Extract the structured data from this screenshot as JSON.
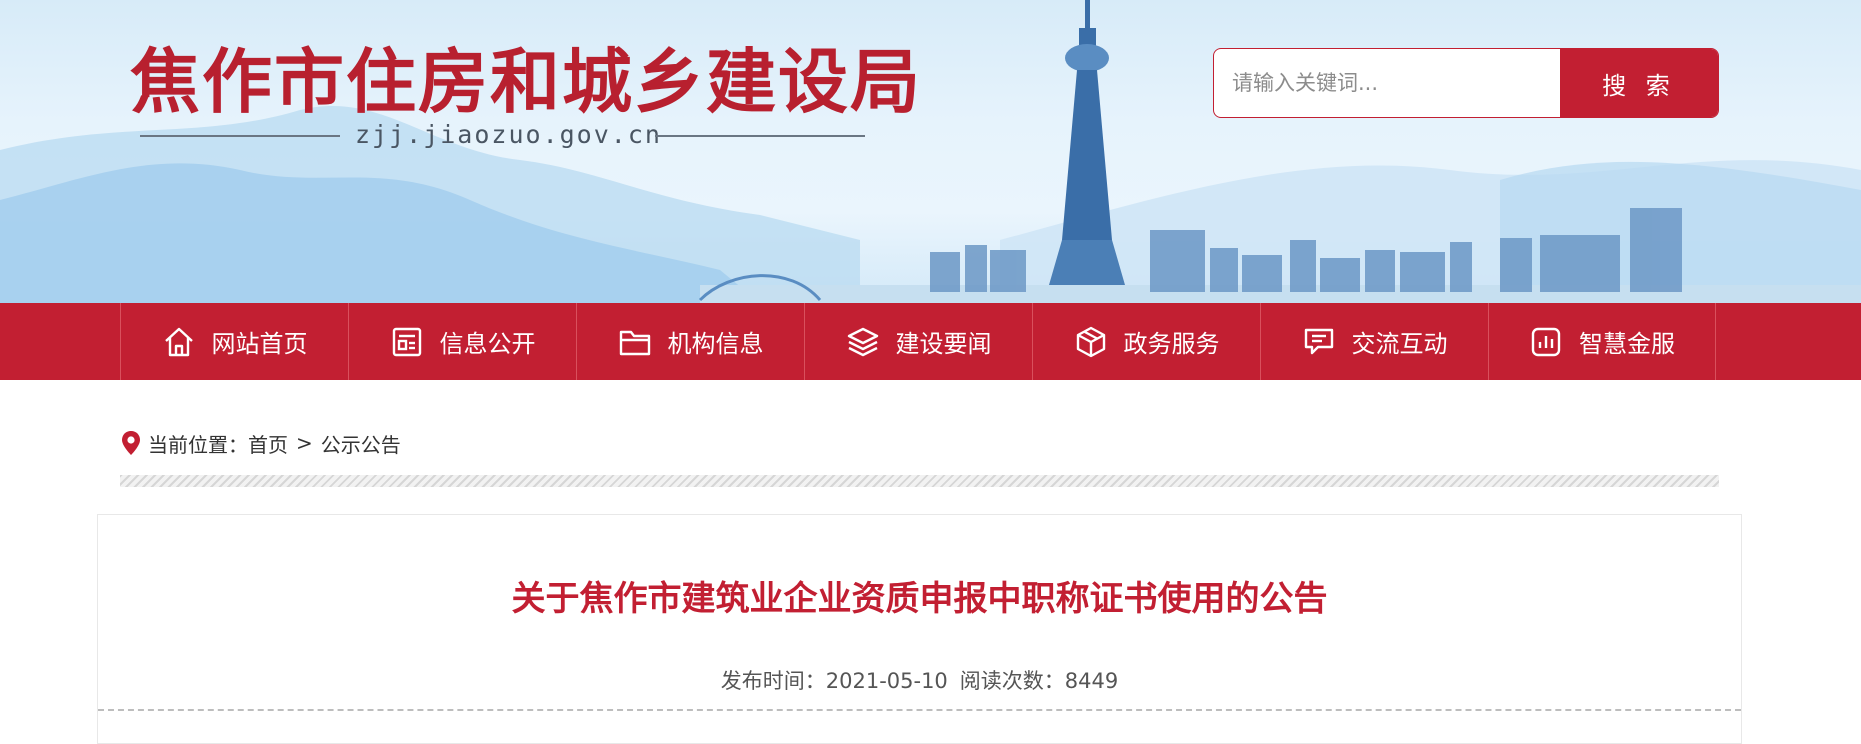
{
  "header": {
    "site_title": "焦作市住房和城乡建设局",
    "domain": "zjj.jiaozuo.gov.cn",
    "search": {
      "placeholder": "请输入关键词...",
      "button_label": "搜 索"
    }
  },
  "nav": {
    "items": [
      {
        "label": "网站首页",
        "icon": "home-icon"
      },
      {
        "label": "信息公开",
        "icon": "document-icon"
      },
      {
        "label": "机构信息",
        "icon": "folder-icon"
      },
      {
        "label": "建设要闻",
        "icon": "layers-icon"
      },
      {
        "label": "政务服务",
        "icon": "cube-icon"
      },
      {
        "label": "交流互动",
        "icon": "chat-icon"
      },
      {
        "label": "智慧金服",
        "icon": "bar-chart-icon"
      }
    ]
  },
  "breadcrumb": {
    "prefix": "当前位置：",
    "items": [
      "首页",
      "公示公告"
    ],
    "separator": ">"
  },
  "article": {
    "title": "关于焦作市建筑业企业资质申报中职称证书使用的公告",
    "publish_label": "发布时间：",
    "publish_date": "2021-05-10",
    "views_label": "阅读次数：",
    "views": "8449"
  },
  "colors": {
    "brand_red": "#c21f32",
    "banner_sky": "#e6f3fc",
    "text": "#333333"
  }
}
